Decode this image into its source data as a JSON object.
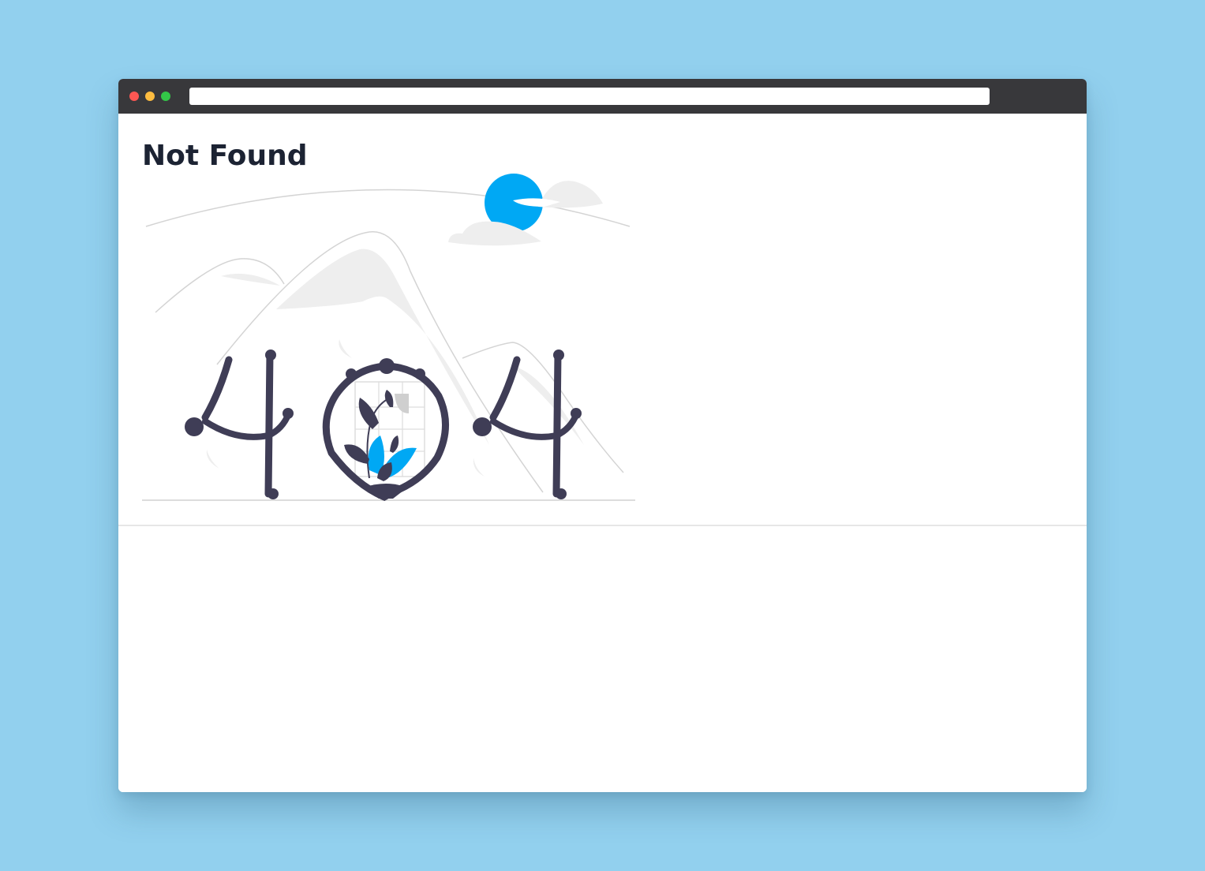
{
  "window": {
    "address_bar": {
      "value": "",
      "placeholder": ""
    },
    "controls": {
      "close_color": "#fc5753",
      "minimize_color": "#fdbc40",
      "maximize_color": "#33c748"
    }
  },
  "page": {
    "title": "Not Found",
    "illustration": {
      "icon": "404-illustration",
      "accent_color": "#00a8f4",
      "glyph_color": "#3f3d56"
    }
  },
  "colors": {
    "background": "#92d0ee",
    "titlebar": "#38383b",
    "heading": "#1c2333"
  }
}
